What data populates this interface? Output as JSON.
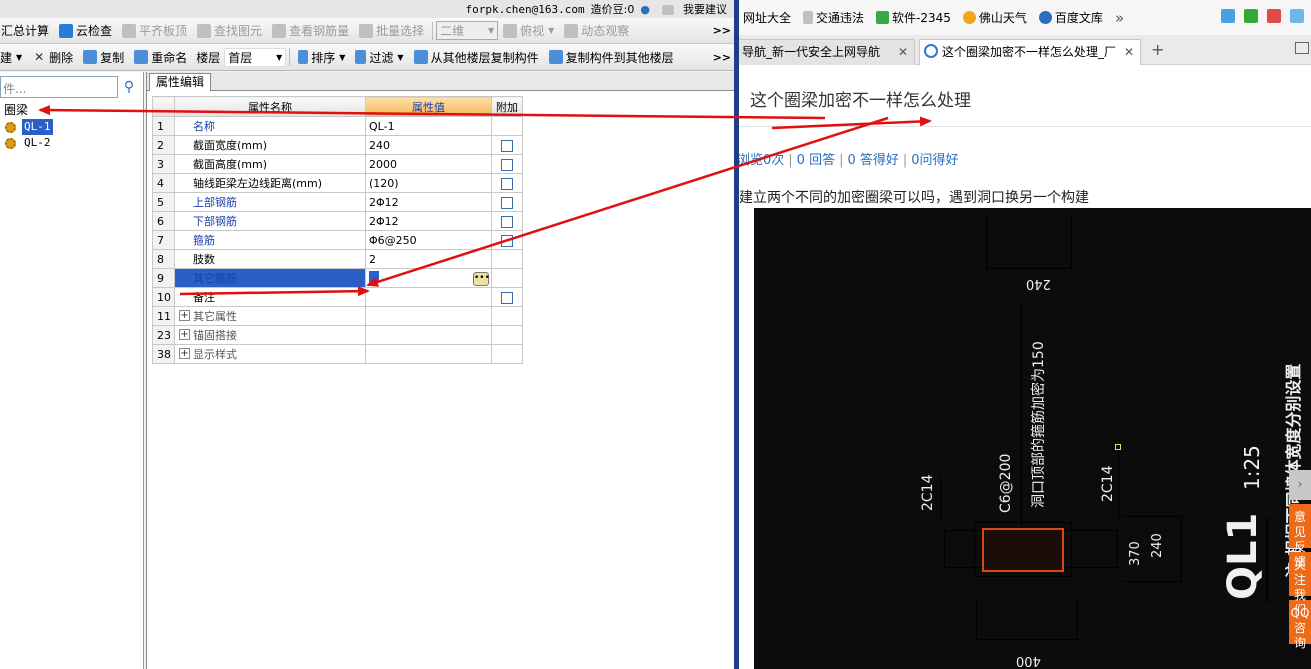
{
  "status_strip": {
    "email": "forpk.chen@163.com",
    "points": "造价豆:0",
    "suggest": "我要建议"
  },
  "toolbar1": {
    "items": [
      "汇总计算",
      "云检查",
      "平齐板顶",
      "查找图元",
      "查看钢筋量",
      "批量选择"
    ],
    "view_mode": "二维",
    "view_angle": "俯视",
    "dynamic": "动态观察",
    "more": ">>"
  },
  "toolbar2": {
    "new_label": "建",
    "delete": "删除",
    "copy": "复制",
    "rename": "重命名",
    "floor_label": "楼层",
    "floor_value": "首层",
    "sort": "排序",
    "filter": "过滤",
    "copy_from": "从其他楼层复制构件",
    "copy_to": "复制构件到其他楼层",
    "more": ">>"
  },
  "left_panel": {
    "search_placeholder": "件...",
    "tree_root": "圈梁",
    "items": [
      "QL-1",
      "QL-2"
    ]
  },
  "prop_panel": {
    "tab": "属性编辑",
    "headers": [
      "属性名称",
      "属性值",
      "附加"
    ],
    "rows": [
      {
        "idx": "1",
        "name": "名称",
        "value": "QL-1"
      },
      {
        "idx": "2",
        "name": "截面宽度(mm)",
        "value": "240"
      },
      {
        "idx": "3",
        "name": "截面高度(mm)",
        "value": "2000"
      },
      {
        "idx": "4",
        "name": "轴线距梁左边线距离(mm)",
        "value": "(120)"
      },
      {
        "idx": "5",
        "name": "上部钢筋",
        "value": "2Φ12"
      },
      {
        "idx": "6",
        "name": "下部钢筋",
        "value": "2Φ12"
      },
      {
        "idx": "7",
        "name": "箍筋",
        "value": "Φ6@250"
      },
      {
        "idx": "8",
        "name": "肢数",
        "value": "2"
      },
      {
        "idx": "9",
        "name": "其它箍筋",
        "value": ""
      },
      {
        "idx": "10",
        "name": "备注",
        "value": ""
      },
      {
        "idx": "11",
        "name": "其它属性",
        "value": ""
      },
      {
        "idx": "23",
        "name": "锚固搭接",
        "value": ""
      },
      {
        "idx": "38",
        "name": "显示样式",
        "value": ""
      }
    ]
  },
  "browser": {
    "bookmarks": [
      "网址大全",
      "交通违法",
      "软件-2345",
      "佛山天气",
      "百度文库"
    ],
    "bookmarks_more": "»",
    "tabs": [
      {
        "label": "导航_新一代安全上网导航"
      },
      {
        "label": "这个圈梁加密不一样怎么处理_厂"
      }
    ],
    "question_title": "这个圈梁加密不一样怎么处理",
    "stats": [
      "浏览0次",
      "0 回答",
      "0 答得好",
      "0问得好"
    ],
    "description": "建立两个不同的加密圈梁可以吗，遇到洞口换另一个构建"
  },
  "photo": {
    "dim_top": "240",
    "note_vertical": "洞口顶部的箍筋加密为150",
    "stirrup_label": "C6@200",
    "left_bar": "2C14",
    "right_bar": "2C14",
    "dim_370": "370",
    "dim_240": "240",
    "dim_bottom": "400",
    "ql_label": "QL1",
    "scale": "1:25",
    "right_note": "注:根据不同墙体宽度分别设置"
  },
  "side_float": [
    "意见反馈",
    "关注我们",
    "QQ咨询"
  ],
  "colors": {
    "selection": "#2a5fc8",
    "arrow": "#e01010",
    "header_highlight": "#f4b75a",
    "float_orange": "#ef6a16"
  }
}
